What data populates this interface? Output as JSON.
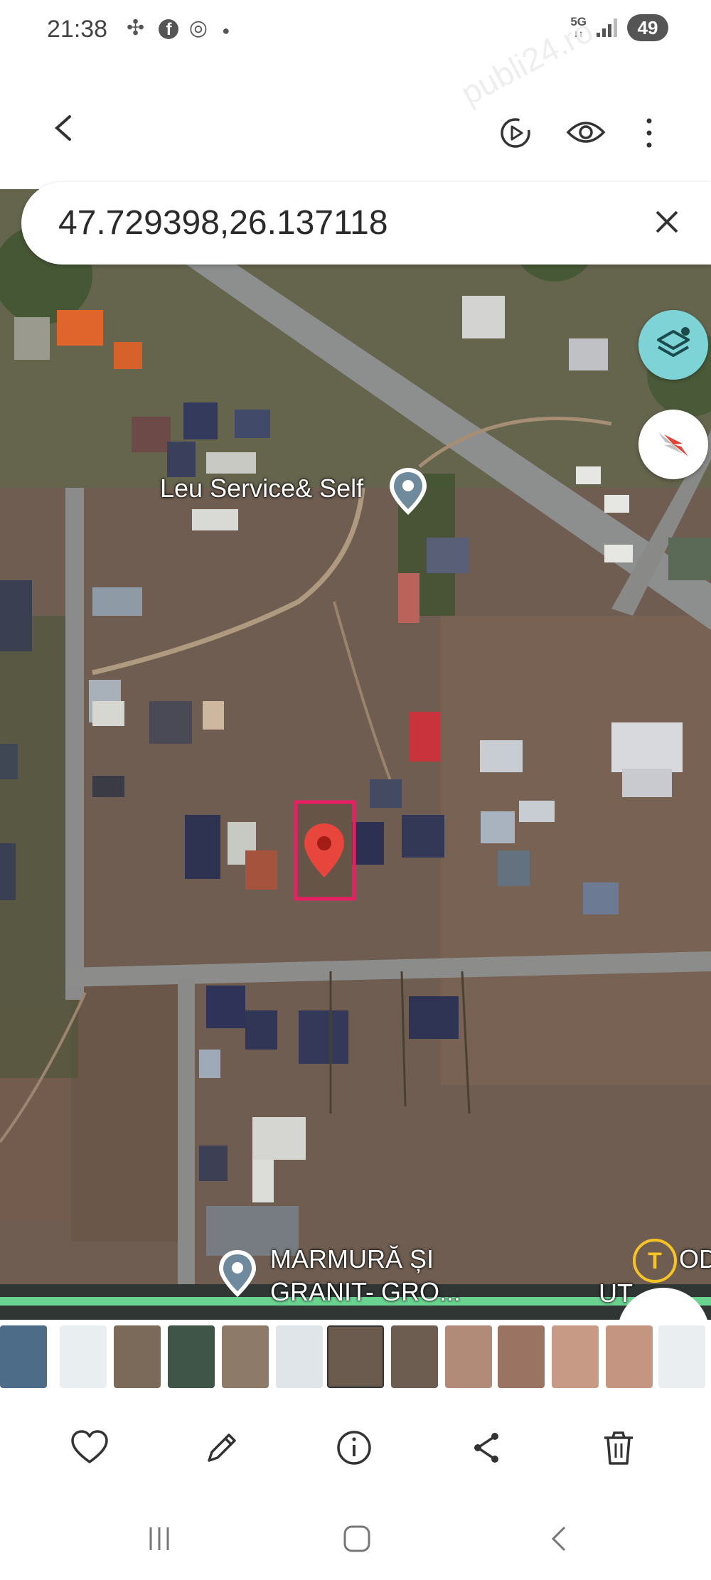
{
  "status_bar": {
    "time": "21:38",
    "network": "5G",
    "battery": "49",
    "notification_icons": [
      "pinwheel-icon",
      "facebook-icon",
      "fingerprint-icon",
      "dot-icon"
    ]
  },
  "app_bar": {
    "icons": [
      "back-arrow-icon",
      "motion-photo-icon",
      "eye-icon",
      "more-vert-icon"
    ]
  },
  "map": {
    "search_value": "47.729398,26.137118",
    "places": [
      {
        "name": "Leu Service& Self"
      },
      {
        "name_line1": "MARMURĂ ȘI",
        "name_line2": "GRANIT- GRO..."
      }
    ],
    "edge_labels": [
      "OD",
      "UT"
    ],
    "accent_pin_color": "#e8463c",
    "highlight_box_color": "#e91e63",
    "layers_button_color": "#7dd3d6"
  },
  "bottom_actions": [
    "favorite-icon",
    "edit-icon",
    "info-icon",
    "share-icon",
    "delete-icon"
  ],
  "nav_bar": [
    "recents-icon",
    "home-icon",
    "back-icon"
  ],
  "watermark": "publi24.ro"
}
